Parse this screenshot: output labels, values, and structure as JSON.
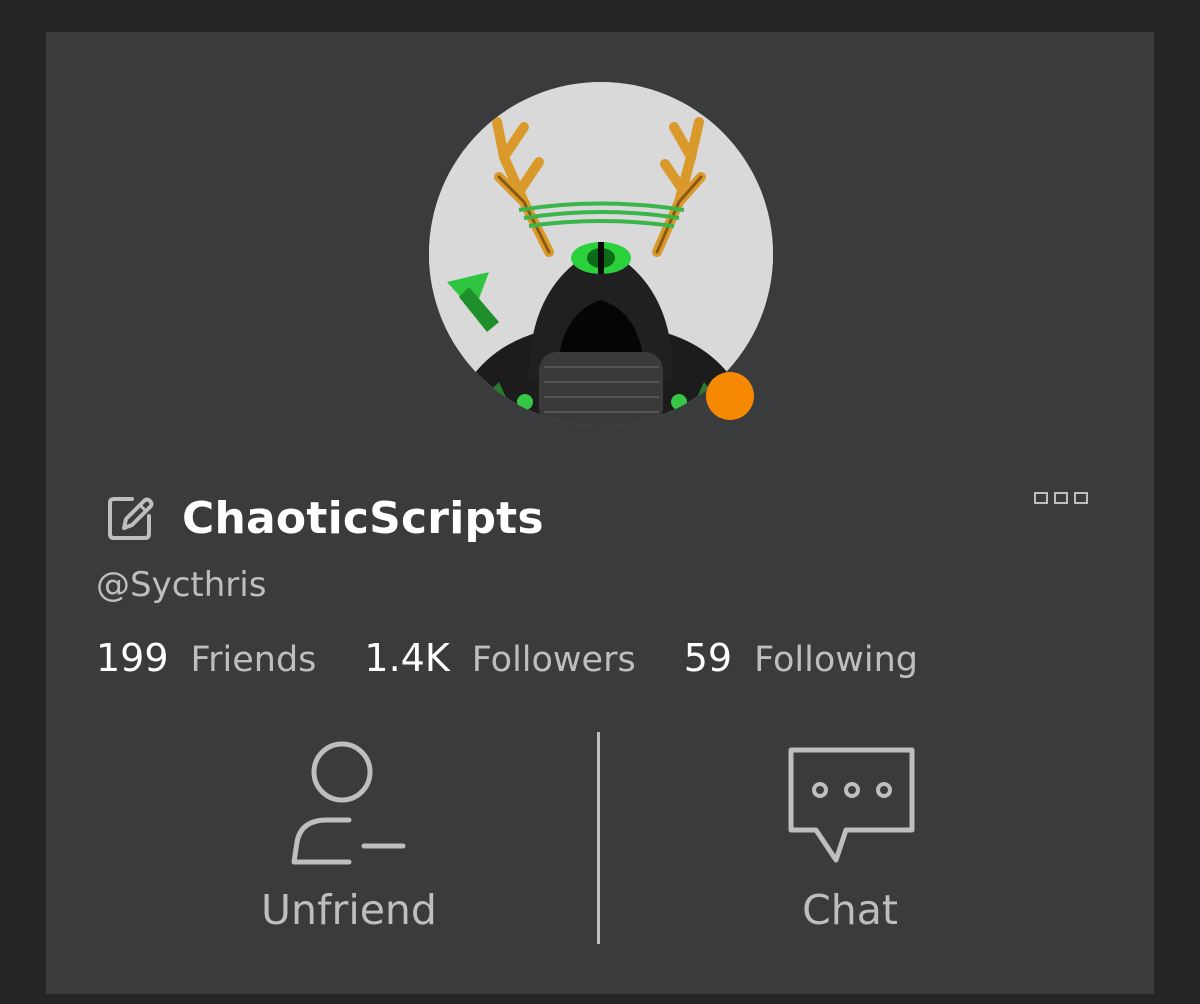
{
  "profile": {
    "display_name": "ChaoticScripts",
    "username": "@Sycthris",
    "status": "online-in-studio",
    "status_color": "#f68802"
  },
  "stats": [
    {
      "value": "199",
      "label": "Friends"
    },
    {
      "value": "1.4K",
      "label": "Followers"
    },
    {
      "value": "59",
      "label": "Following"
    }
  ],
  "actions": {
    "unfriend_label": "Unfriend",
    "chat_label": "Chat"
  },
  "icons": {
    "edit": "edit-icon",
    "more": "more-options-icon",
    "unfriend": "unfriend-icon",
    "chat": "chat-icon"
  },
  "theme": {
    "background": "#232527",
    "card": "#393b3d",
    "text_primary": "#ffffff",
    "text_secondary": "#bdbebe"
  }
}
